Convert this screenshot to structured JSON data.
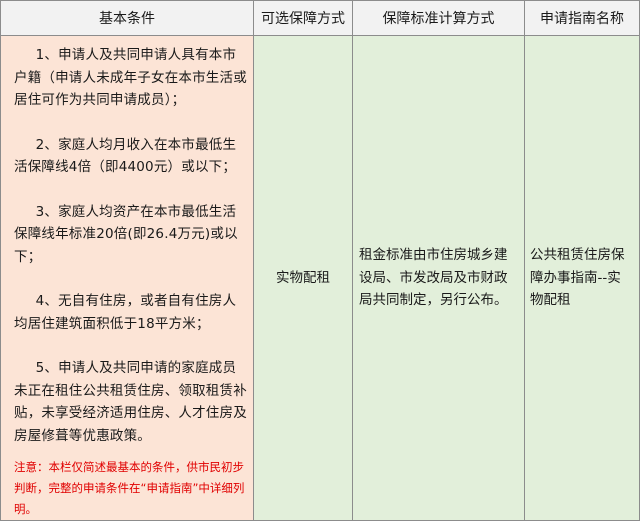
{
  "table": {
    "headers": [
      "基本条件",
      "可选保障方式",
      "保障标准计算方式",
      "申请指南名称"
    ],
    "conditions": [
      "1、申请人及共同申请人具有本市户籍（申请人未成年子女在本市生活或居住可作为共同申请成员）；",
      "2、家庭人均月收入在本市最低生活保障线4倍（即4400元）或以下；",
      "3、家庭人均资产在本市最低生活保障线年标准20倍(即26.4万元)或以下；",
      "4、无自有住房，或者自有住房人均居住建筑面积低于18平方米；",
      "5、申请人及共同申请的家庭成员未正在租住公共租赁住房、领取租赁补贴，未享受经济适用住房、人才住房及房屋修葺等优惠政策。"
    ],
    "note": "注意：本栏仅简述最基本的条件，供市民初步判断，完整的申请条件在“申请指南”中详细列明。",
    "method": "实物配租",
    "standard": "租金标准由市住房城乡建设局、市发改局及市财政局共同制定，另行公布。",
    "guide": "公共租赁住房保障办事指南--实物配租"
  },
  "colors": {
    "header_bg": "#f2f2f2",
    "conditions_bg": "#fce4d6",
    "other_bg": "#e2efda",
    "note_text": "#e00000",
    "border": "#8c8c8c"
  }
}
